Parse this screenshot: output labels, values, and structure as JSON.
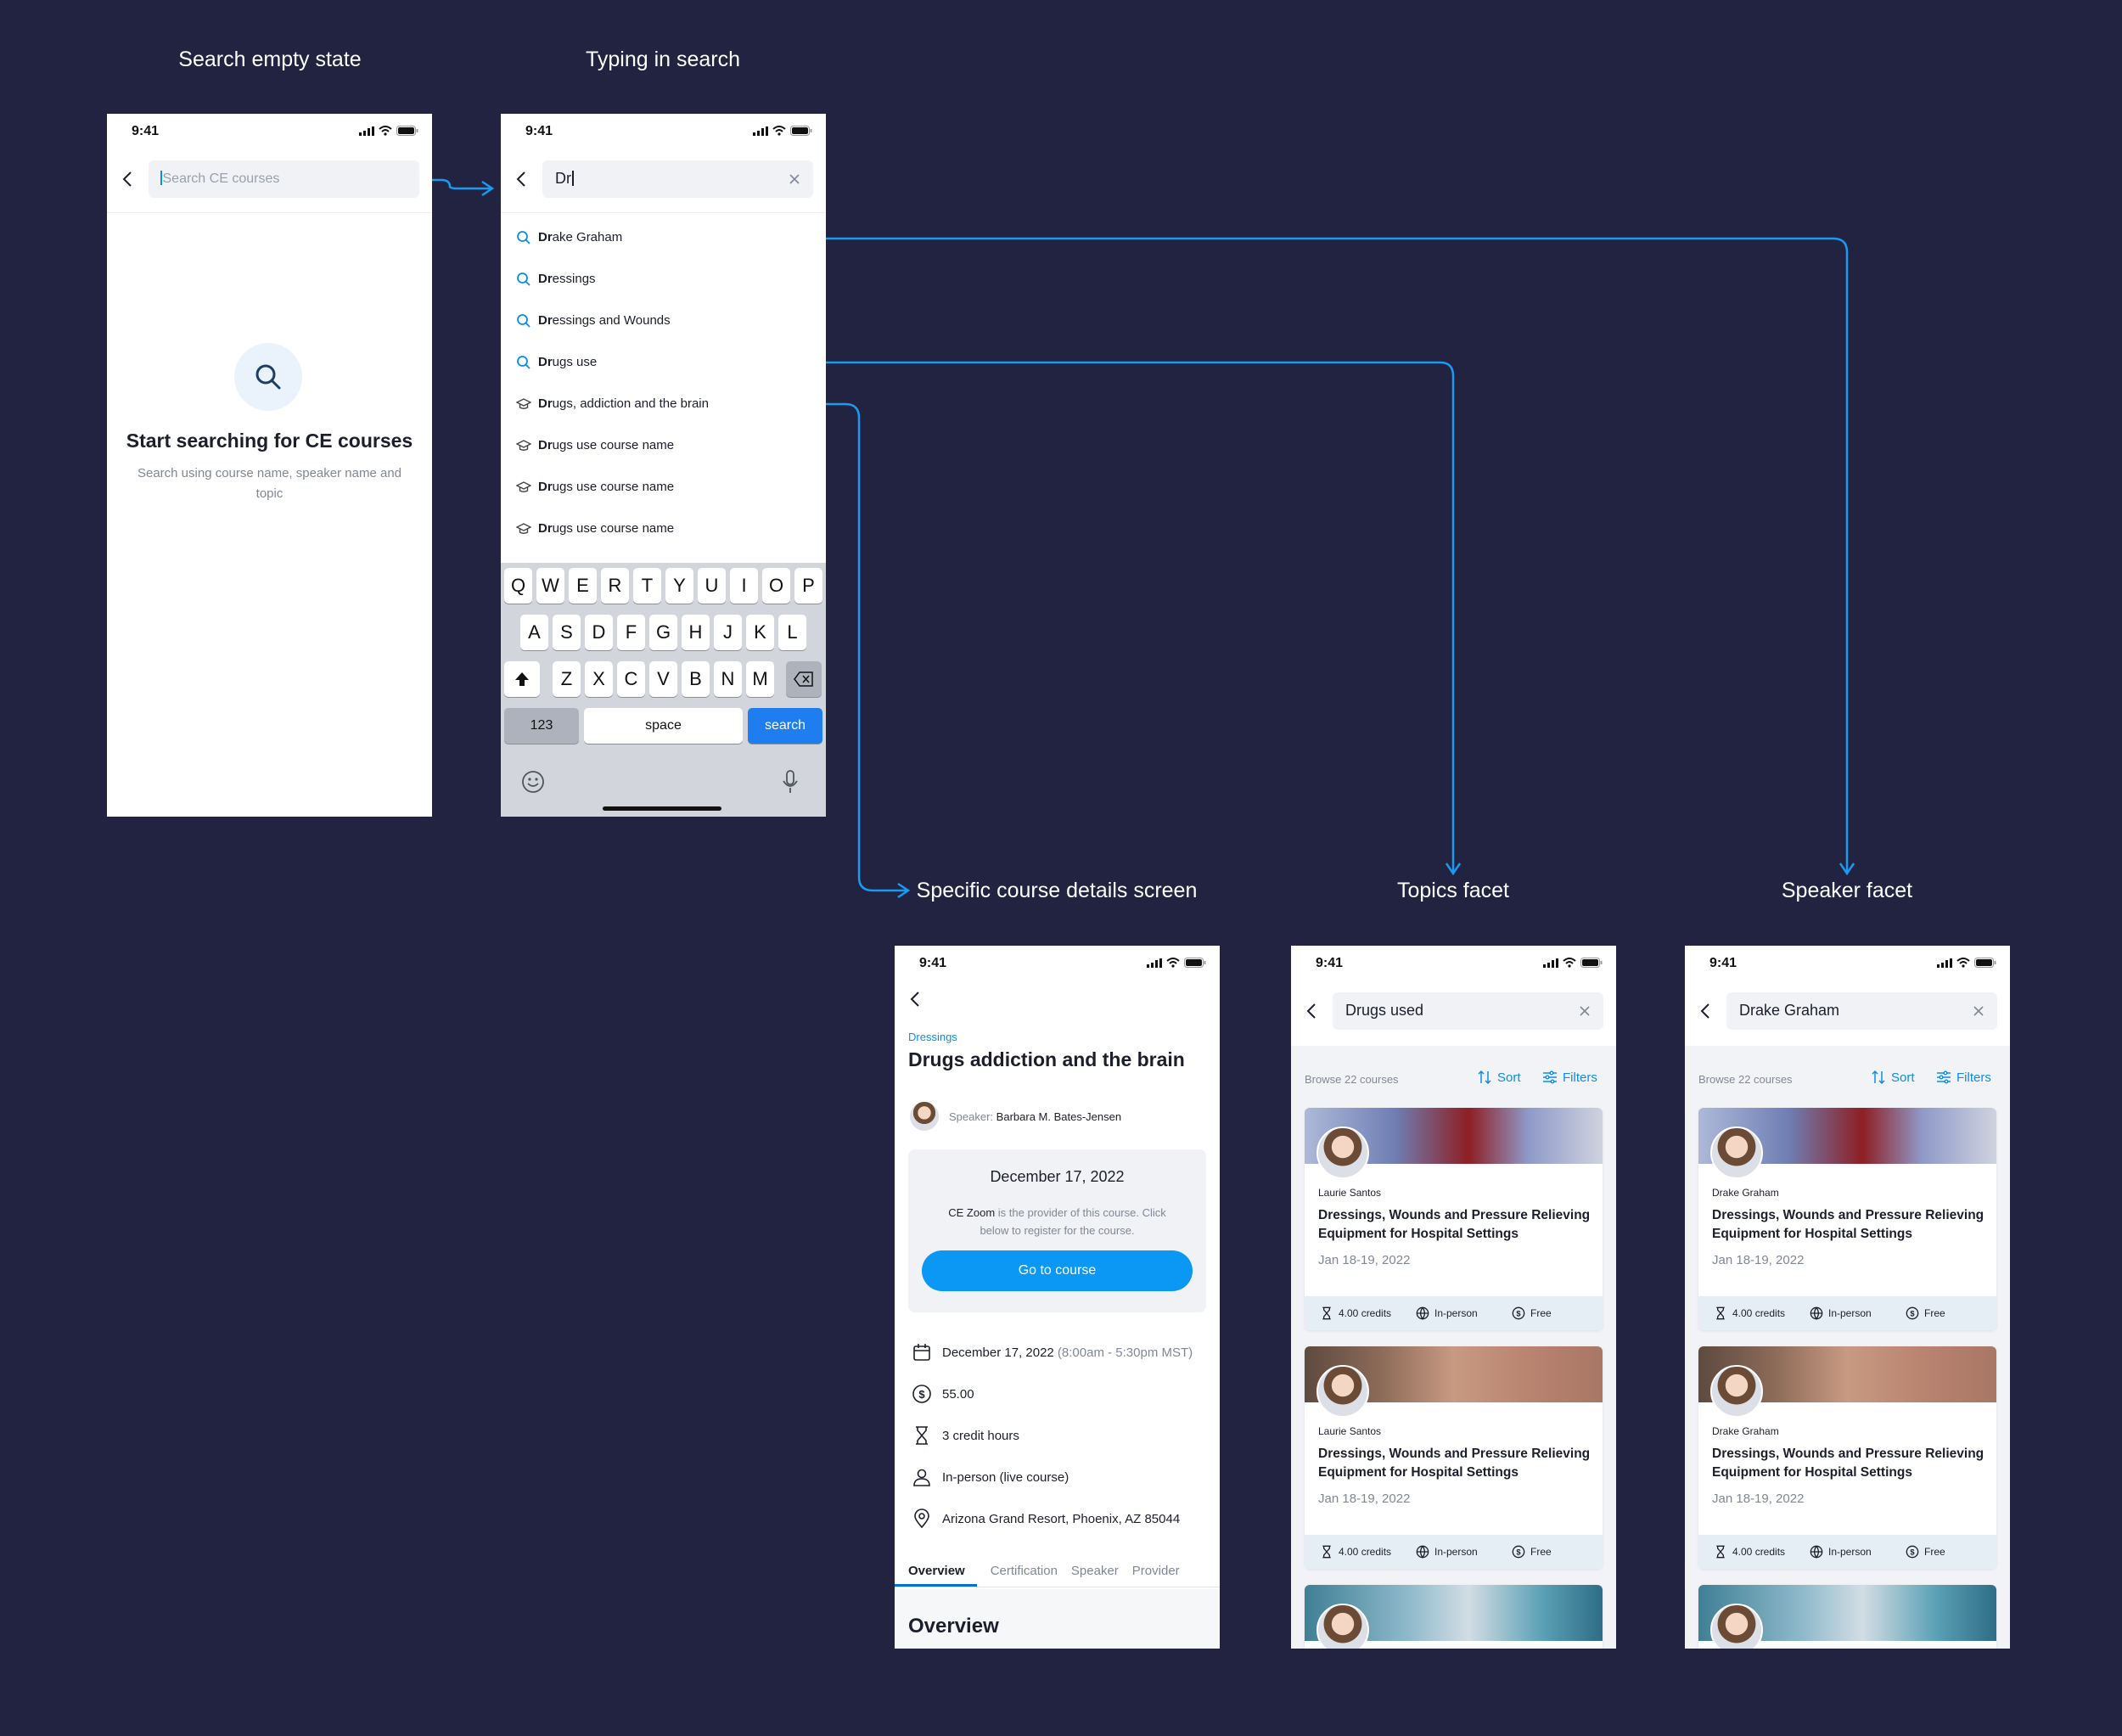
{
  "titles": {
    "t1": "Search empty state",
    "t2": "Typing in search",
    "t3": "Specific course details screen",
    "t4": "Topics facet",
    "t5": "Speaker facet"
  },
  "time": "9:41",
  "colors": {
    "background": "#222341",
    "accent": "#0b8ee8",
    "connector": "#1a9af0",
    "button": "#0b97f4"
  },
  "screen1": {
    "search_placeholder": "Search CE courses",
    "empty_heading": "Start searching for CE courses",
    "empty_sub": "Search using course name, speaker name and topic"
  },
  "screen2": {
    "query": "Dr",
    "suggestions": [
      {
        "icon": "search-icon",
        "bold": "Dr",
        "rest": "ake Graham"
      },
      {
        "icon": "search-icon",
        "bold": "Dr",
        "rest": "essings"
      },
      {
        "icon": "search-icon",
        "bold": "Dr",
        "rest": "essings and Wounds"
      },
      {
        "icon": "search-icon",
        "bold": "Dr",
        "rest": "ugs use"
      },
      {
        "icon": "graduation-cap-icon",
        "bold": "Dr",
        "rest": "ugs, addiction and the brain"
      },
      {
        "icon": "graduation-cap-icon",
        "bold": "Dr",
        "rest": "ugs use course name"
      },
      {
        "icon": "graduation-cap-icon",
        "bold": "Dr",
        "rest": "ugs use course name"
      },
      {
        "icon": "graduation-cap-icon",
        "bold": "Dr",
        "rest": "ugs use course name"
      }
    ],
    "keyboard": {
      "row1": [
        "Q",
        "W",
        "E",
        "R",
        "T",
        "Y",
        "U",
        "I",
        "O",
        "P"
      ],
      "row2": [
        "A",
        "S",
        "D",
        "F",
        "G",
        "H",
        "J",
        "K",
        "L"
      ],
      "row3": [
        "Z",
        "X",
        "C",
        "V",
        "B",
        "N",
        "M"
      ],
      "numbers": "123",
      "space": "space",
      "search": "search"
    }
  },
  "details": {
    "category": "Dressings",
    "title": "Drugs addiction and the brain",
    "speaker_label": "Speaker:",
    "speaker_name": "Barbara M. Bates-Jensen",
    "box_date": "December 17, 2022",
    "provider_name": "CE Zoom",
    "provider_note": "is the provider of this course. Click below to register for the course.",
    "cta": "Go to course",
    "date": "December 17, 2022",
    "date_time": "(8:00am - 5:30pm MST)",
    "price": "55.00",
    "credits": "3 credit hours",
    "format": "In-person (live course)",
    "location": "Arizona Grand Resort, Phoenix, AZ 85044",
    "tabs": [
      "Overview",
      "Certification",
      "Speaker",
      "Provider"
    ],
    "section_heading": "Overview"
  },
  "topics": {
    "query": "Drugs used",
    "browse": "Browse 22 courses",
    "sort": "Sort",
    "filters": "Filters",
    "cards": [
      {
        "author": "Laurie Santos",
        "title": "Dressings, Wounds and Pressure Relieving Equipment for Hospital Settings",
        "date": "Jan 18-19, 2022",
        "credits": "4.00 credits",
        "format": "In-person",
        "price": "Free"
      },
      {
        "author": "Laurie Santos",
        "title": "Dressings, Wounds and Pressure Relieving Equipment for Hospital Settings",
        "date": "Jan 18-19, 2022",
        "credits": "4.00 credits",
        "format": "In-person",
        "price": "Free"
      }
    ]
  },
  "speaker": {
    "query": "Drake Graham",
    "browse": "Browse 22 courses",
    "sort": "Sort",
    "filters": "Filters",
    "cards": [
      {
        "author": "Drake Graham",
        "title": "Dressings, Wounds and Pressure Relieving Equipment for Hospital Settings",
        "date": "Jan 18-19, 2022",
        "credits": "4.00 credits",
        "format": "In-person",
        "price": "Free"
      },
      {
        "author": "Drake Graham",
        "title": "Dressings, Wounds and Pressure Relieving Equipment for Hospital Settings",
        "date": "Jan 18-19, 2022",
        "credits": "4.00 credits",
        "format": "In-person",
        "price": "Free"
      }
    ]
  }
}
